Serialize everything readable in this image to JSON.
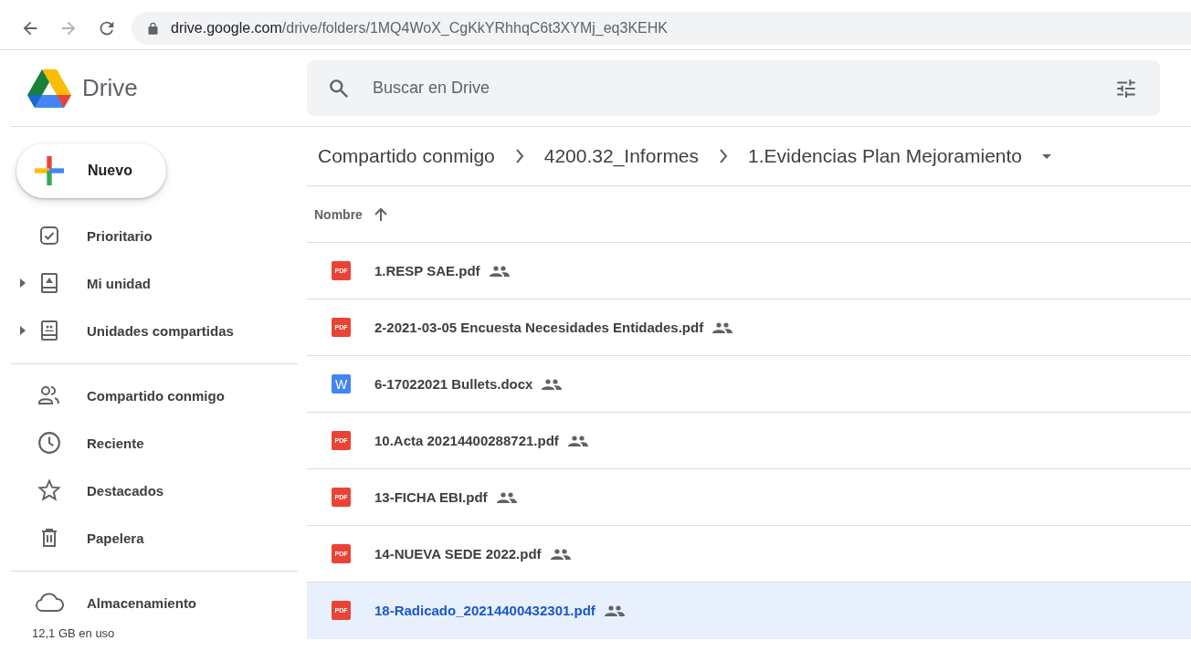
{
  "browser": {
    "url_host": "drive.google.com",
    "url_path": "/drive/folders/1MQ4WoX_CgKkYRhhqC6t3XYMj_eq3KEHK"
  },
  "header": {
    "app_name": "Drive",
    "search": {
      "placeholder": "Buscar en Drive"
    }
  },
  "sidebar": {
    "new_button": "Nuevo",
    "groups": [
      [
        {
          "label": "Prioritario",
          "expandable": false
        },
        {
          "label": "Mi unidad",
          "expandable": true
        },
        {
          "label": "Unidades compartidas",
          "expandable": true
        }
      ],
      [
        {
          "label": "Compartido conmigo",
          "expandable": false
        },
        {
          "label": "Reciente",
          "expandable": false
        },
        {
          "label": "Destacados",
          "expandable": false
        },
        {
          "label": "Papelera",
          "expandable": false
        }
      ],
      [
        {
          "label": "Almacenamiento",
          "expandable": false
        }
      ]
    ],
    "storage_usage": "12,1 GB en uso"
  },
  "breadcrumb": [
    "Compartido conmigo",
    "4200.32_Informes",
    "1.Evidencias Plan Mejoramiento"
  ],
  "table": {
    "columns": [
      "Nombre"
    ],
    "rows": [
      {
        "name": "1.RESP SAE.pdf",
        "kind": "pdf",
        "badge": "PDF",
        "shared": true,
        "selected": false
      },
      {
        "name": "2-2021-03-05 Encuesta Necesidades Entidades.pdf",
        "kind": "pdf",
        "badge": "PDF",
        "shared": true,
        "selected": false
      },
      {
        "name": "6-17022021 Bullets.docx",
        "kind": "word",
        "badge": "W",
        "shared": true,
        "selected": false
      },
      {
        "name": "10.Acta 20214400288721.pdf",
        "kind": "pdf",
        "badge": "PDF",
        "shared": true,
        "selected": false
      },
      {
        "name": "13-FICHA EBI.pdf",
        "kind": "pdf",
        "badge": "PDF",
        "shared": true,
        "selected": false
      },
      {
        "name": "14-NUEVA SEDE 2022.pdf",
        "kind": "pdf",
        "badge": "PDF",
        "shared": true,
        "selected": false
      },
      {
        "name": "18-Radicado_20214400432301.pdf",
        "kind": "pdf",
        "badge": "PDF",
        "shared": true,
        "selected": true
      }
    ]
  }
}
